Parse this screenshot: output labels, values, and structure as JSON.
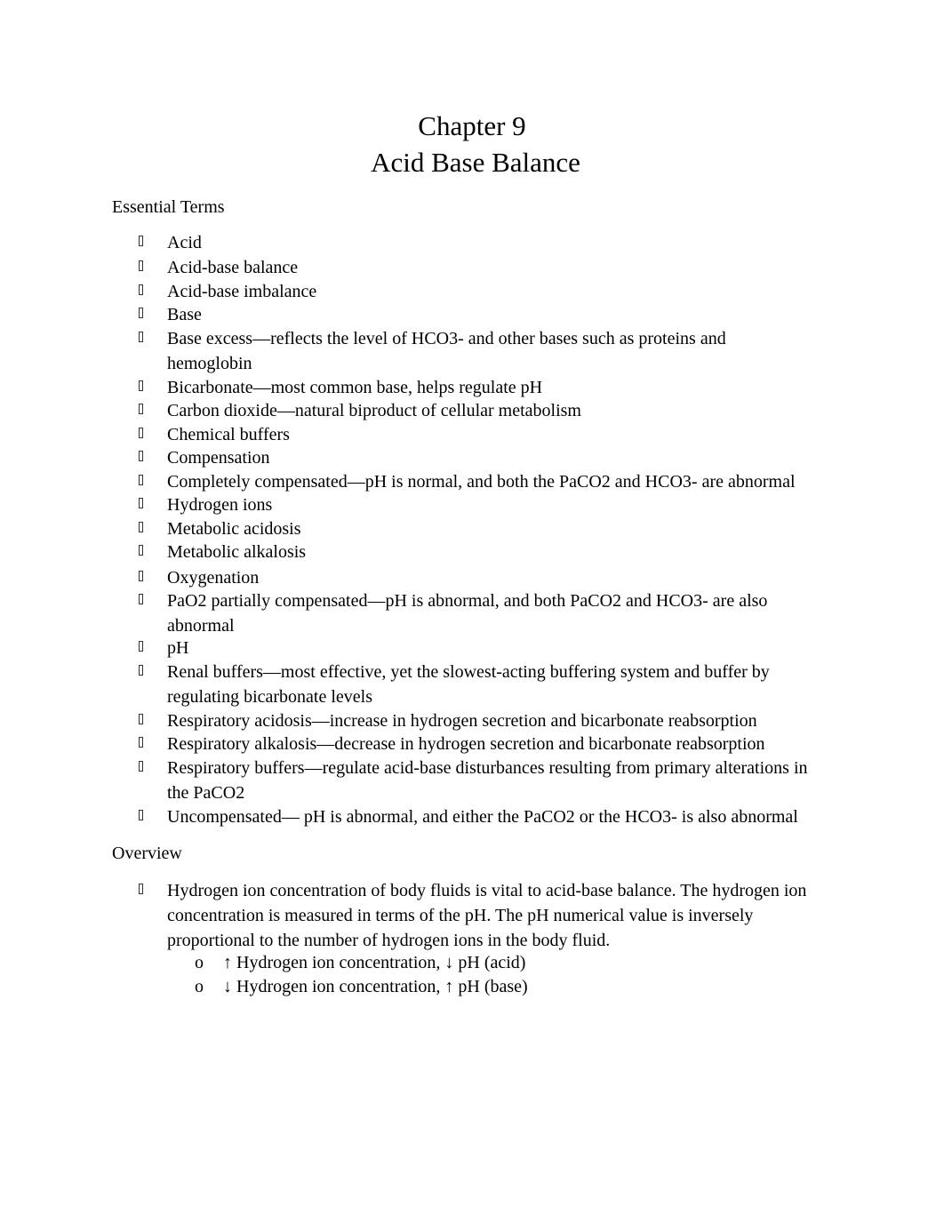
{
  "document": {
    "title_line1": "Chapter 9",
    "title_line2": "Acid Base Balance",
    "sections": {
      "essential_terms": {
        "heading": "Essential Terms",
        "bullet_icon": "missing-glyph-box",
        "items": [
          "Acid",
          "Acid-base balance",
          "Acid-base imbalance",
          "Base",
          "Base excess—reflects the level of HCO3- and other bases such as proteins and hemoglobin",
          "Bicarbonate—most common base, helps regulate pH",
          "Carbon dioxide—natural biproduct of cellular metabolism",
          "Chemical buffers",
          "Compensation",
          "Completely compensated—pH is normal, and both the PaCO2 and HCO3- are abnormal",
          "Hydrogen ions",
          "Metabolic acidosis",
          "Metabolic alkalosis",
          "Oxygenation",
          "PaO2 partially compensated—pH is abnormal, and both PaCO2 and HCO3- are also abnormal",
          "pH",
          "Renal buffers—most effective, yet the slowest-acting buffering system and buffer by regulating bicarbonate levels",
          "Respiratory acidosis—increase in hydrogen secretion and bicarbonate reabsorption",
          "Respiratory alkalosis—decrease in hydrogen secretion and bicarbonate reabsorption",
          "Respiratory buffers—regulate acid-base disturbances resulting from primary alterations in the PaCO2",
          "Uncompensated— pH is abnormal, and either the PaCO2 or the HCO3- is also abnormal"
        ]
      },
      "overview": {
        "heading": "Overview",
        "items": [
          {
            "text": "Hydrogen ion concentration of body fluids is vital to acid-base balance. The hydrogen ion concentration is measured in terms of the pH. The pH numerical value is inversely proportional to the number of hydrogen ions in the body fluid.",
            "sub_bullet": "o",
            "sub_items": [
              "↑ Hydrogen ion concentration, ↓ pH (acid)",
              "↓ Hydrogen ion concentration, ↑ pH (base)"
            ]
          }
        ]
      }
    }
  }
}
